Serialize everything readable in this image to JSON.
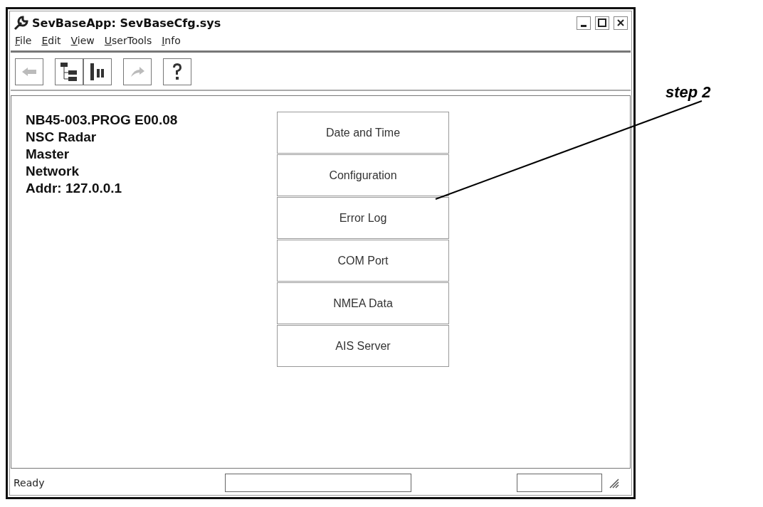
{
  "window": {
    "title": "SevBaseApp: SevBaseCfg.sys"
  },
  "menu": [
    {
      "label": "File"
    },
    {
      "label": "Edit"
    },
    {
      "label": "View"
    },
    {
      "label": "UserTools"
    },
    {
      "label": "Info"
    }
  ],
  "toolbar": [
    {
      "kind": "back",
      "disabled": true
    },
    {
      "kind": "tree",
      "disabled": false
    },
    {
      "kind": "list",
      "disabled": false
    },
    {
      "kind": "forward",
      "disabled": true
    },
    {
      "kind": "help",
      "disabled": false
    }
  ],
  "info_lines": [
    "NB45-003.PROG E00.08",
    "NSC Radar",
    "Master",
    "Network",
    "Addr: 127.0.0.1"
  ],
  "buttons": [
    "Date and Time",
    "Configuration",
    "Error Log",
    "COM Port",
    "NMEA Data",
    "AIS Server"
  ],
  "status_bar": {
    "text": "Ready"
  },
  "annotation": {
    "label": "step 2"
  }
}
